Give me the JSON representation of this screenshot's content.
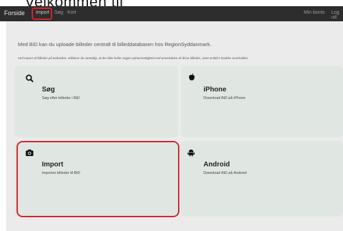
{
  "header_fragment": "Velkommen til",
  "nav": {
    "brand": "Forside",
    "links": [
      "Import",
      "Søg",
      "Kort"
    ],
    "right_links": [
      "Min konto",
      "Log ud"
    ]
  },
  "intro": "Med BiD kan du uploade billeder centralt til billeddatabasen hos RegionSyddanmark.",
  "notice": "Ved import af billeder på websiden, erklærer du samtidig, at der ikke hviler nogen ophavsrettighed ved anvendelse af disse billeder, samt at BiD's kodeks overholdes.",
  "cards": {
    "sog": {
      "title": "Søg",
      "subtitle": "Søg efter billeder i BiD",
      "icon": "search-icon"
    },
    "iphone": {
      "title": "iPhone",
      "subtitle": "Download BiD på iPhone",
      "icon": "apple-icon"
    },
    "import": {
      "title": "Import",
      "subtitle": "Importer billeder til BiD",
      "icon": "camera-icon"
    },
    "android": {
      "title": "Android",
      "subtitle": "Download BiD på Android",
      "icon": "android-icon"
    }
  },
  "colors": {
    "navbar": "#2d2d2d",
    "card": "#e0e7e3",
    "highlight": "#d8232a"
  }
}
